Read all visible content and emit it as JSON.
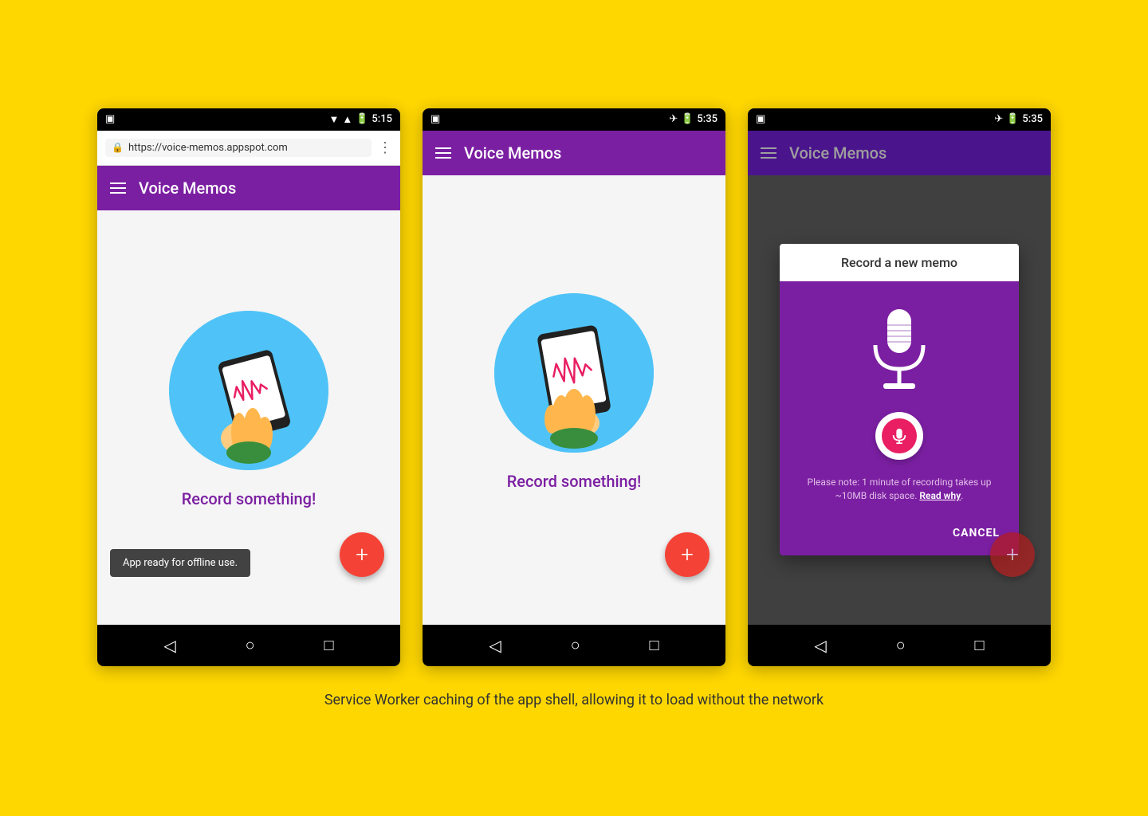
{
  "background_color": "#FFD700",
  "caption": "Service Worker caching of the app shell, allowing it to load without the network",
  "phone1": {
    "status_bar": {
      "time": "5:15",
      "icons": [
        "signal",
        "wifi",
        "battery"
      ]
    },
    "browser_url": "https://voice-memos.appspot.com",
    "app_title": "Voice Memos",
    "record_text": "Record something!",
    "fab_label": "+",
    "snackbar_text": "App ready for offline use.",
    "nav_buttons": [
      "back",
      "home",
      "recents"
    ]
  },
  "phone2": {
    "status_bar": {
      "time": "5:35",
      "icons": [
        "airplane",
        "battery"
      ]
    },
    "app_title": "Voice Memos",
    "record_text": "Record something!",
    "fab_label": "+",
    "nav_buttons": [
      "back",
      "home",
      "recents"
    ]
  },
  "phone3": {
    "status_bar": {
      "time": "5:35",
      "icons": [
        "airplane",
        "battery"
      ]
    },
    "app_title": "Voice Memos",
    "dialog": {
      "title": "Record a new memo",
      "note": "Please note: 1 minute of recording takes up ~10MB disk space.",
      "read_why": "Read why",
      "cancel_label": "CANCEL"
    },
    "fab_label": "+",
    "nav_buttons": [
      "back",
      "home",
      "recents"
    ]
  }
}
